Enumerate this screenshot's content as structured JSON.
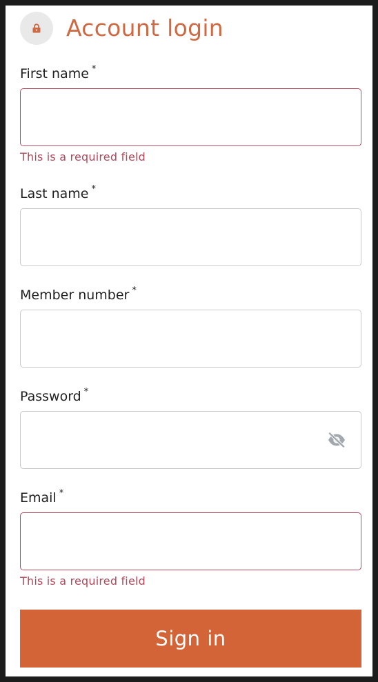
{
  "header": {
    "title": "Account login",
    "icon": "lock-icon"
  },
  "fields": {
    "first_name": {
      "label": "First name",
      "required_mark": "*",
      "value": "",
      "error": "This is a required field"
    },
    "last_name": {
      "label": "Last name",
      "required_mark": "*",
      "value": ""
    },
    "member_number": {
      "label": "Member number",
      "required_mark": "*",
      "value": ""
    },
    "password": {
      "label": "Password",
      "required_mark": "*",
      "value": "",
      "toggle_icon": "eye-slash-icon"
    },
    "email": {
      "label": "Email",
      "required_mark": "*",
      "value": "",
      "error": "This is a required field"
    }
  },
  "submit": {
    "label": "Sign in"
  },
  "colors": {
    "accent": "#d26437",
    "title": "#cd6a44",
    "error": "#b0495a",
    "border": "#c9c9c9"
  }
}
